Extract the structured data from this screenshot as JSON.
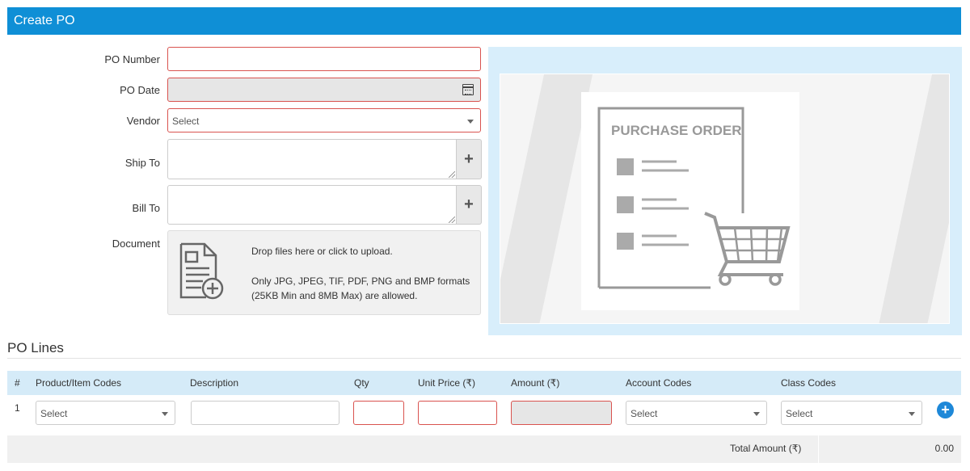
{
  "header": {
    "title": "Create PO"
  },
  "form": {
    "po_number_label": "PO Number",
    "po_date_label": "PO Date",
    "vendor_label": "Vendor",
    "vendor_placeholder": "Select",
    "ship_to_label": "Ship To",
    "bill_to_label": "Bill To",
    "add_symbol": "+",
    "document_label": "Document",
    "upload_line1": "Drop files here or click to upload.",
    "upload_line2": "Only JPG, JPEG, TIF, PDF, PNG and BMP formats",
    "upload_line3": "(25KB Min and 8MB Max) are allowed."
  },
  "illustration": {
    "title": "PURCHASE ORDER"
  },
  "lines": {
    "section_title": "PO Lines",
    "columns": [
      "#",
      "Product/Item Codes",
      "Description",
      "Qty",
      "Unit Price (₹)",
      "Amount (₹)",
      "Account Codes",
      "Class Codes"
    ],
    "rows": [
      {
        "num": "1",
        "product": "Select",
        "account": "Select",
        "class": "Select"
      }
    ],
    "add_symbol": "+",
    "total_label": "Total Amount (₹)",
    "total_value": "0.00"
  }
}
